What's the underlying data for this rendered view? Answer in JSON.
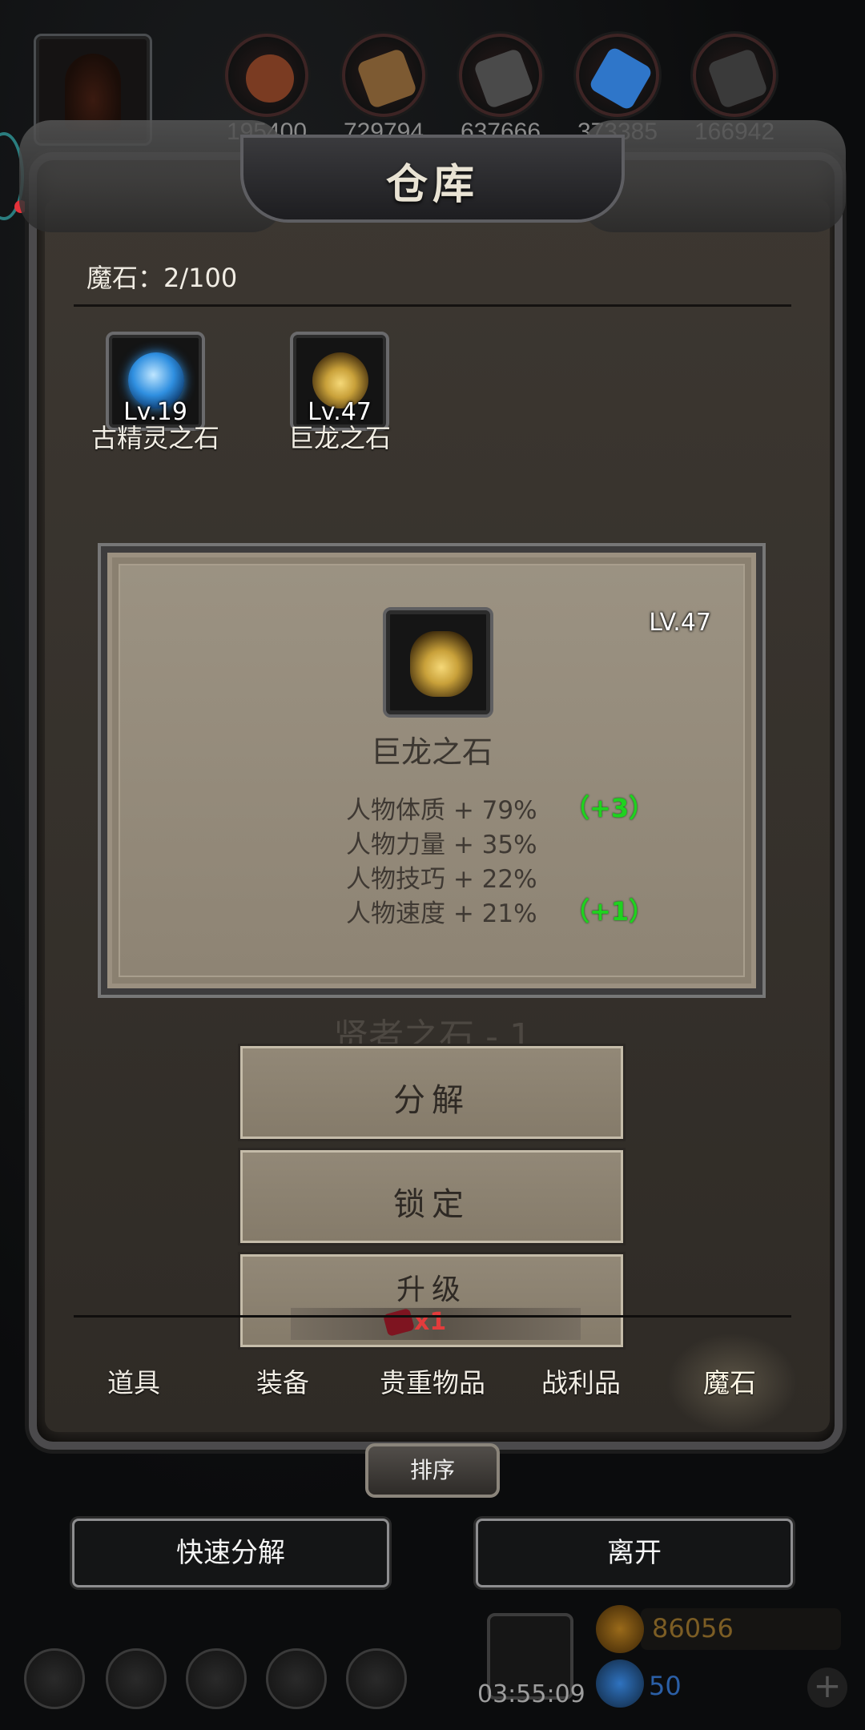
{
  "resources": [
    {
      "name": "meat",
      "value": "195400",
      "color": "#7a3b22"
    },
    {
      "name": "wood",
      "value": "729794",
      "color": "#7d5a32"
    },
    {
      "name": "iron",
      "value": "637666",
      "color": "#4a4a4a"
    },
    {
      "name": "crystal",
      "value": "373385",
      "color": "#2f76c9"
    },
    {
      "name": "stone",
      "value": "166942",
      "color": "#3a3a3a"
    }
  ],
  "title": "仓库",
  "magic_stone_count": "魔石：2/100",
  "items": [
    {
      "name": "古精灵之石",
      "level": "Lv.19",
      "icon": "blue-orb-icon",
      "color": "#2f8fe0"
    },
    {
      "name": "巨龙之石",
      "level": "Lv.47",
      "icon": "gold-dragon-icon",
      "color": "#c9a13a"
    }
  ],
  "detail": {
    "level": "LV.47",
    "name": "巨龙之石",
    "stats": [
      {
        "label": "人物体质 + 79%",
        "bonus": "（+3）"
      },
      {
        "label": "人物力量 + 35%",
        "bonus": ""
      },
      {
        "label": "人物技巧 + 22%",
        "bonus": ""
      },
      {
        "label": "人物速度 + 21%",
        "bonus": "（+1）"
      }
    ]
  },
  "ghost_text": "贤者之石 - 1",
  "buttons": {
    "decompose": "分解",
    "lock": "锁定",
    "upgrade": "升级",
    "upgrade_cost": "x1"
  },
  "tabs": [
    "道具",
    "装备",
    "贵重物品",
    "战利品",
    "魔石"
  ],
  "selected_tab": "魔石",
  "sort_label": "排序",
  "quick_decompose": "快速分解",
  "leave": "离开",
  "timer": "03:55:09",
  "gold": "86056",
  "gems": "50"
}
